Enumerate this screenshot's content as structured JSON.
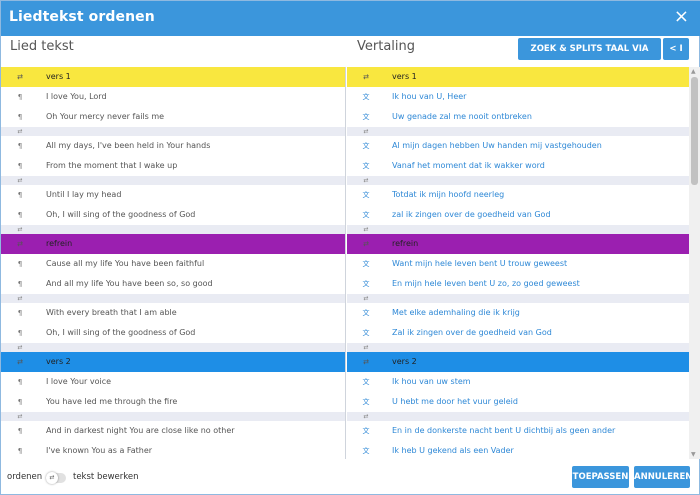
{
  "dialog": {
    "title": "Liedtekst ordenen",
    "close_icon": "×"
  },
  "columns": {
    "left_title": "Lied tekst",
    "right_title": "Vertaling"
  },
  "toolbar": {
    "deepl_label": "ZOEK & SPLITS TAAL VIA DEEPL",
    "collapse_label": "< I"
  },
  "icons": {
    "swap": "⇄",
    "para": "¶",
    "translate": "文"
  },
  "colors": {
    "accent": "#3b96dc",
    "vers": "#f9e73f",
    "refrein": "#9b1fb0",
    "vers2": "#1e8ee6"
  },
  "left": [
    {
      "kind": "header",
      "variant": "vers",
      "text": "vers 1"
    },
    {
      "kind": "line",
      "text": "I love You, Lord"
    },
    {
      "kind": "line",
      "text": "Oh Your mercy never fails me"
    },
    {
      "kind": "sep"
    },
    {
      "kind": "line",
      "text": "All my days, I've been held in Your hands"
    },
    {
      "kind": "line",
      "text": "From the moment that I wake up"
    },
    {
      "kind": "sep"
    },
    {
      "kind": "line",
      "text": "Until I lay my head"
    },
    {
      "kind": "line",
      "text": "Oh, I will sing of the goodness of God"
    },
    {
      "kind": "sep"
    },
    {
      "kind": "header",
      "variant": "refrein",
      "text": "refrein"
    },
    {
      "kind": "line",
      "text": "Cause all my life You have been faithful"
    },
    {
      "kind": "line",
      "text": "And all my life You have been so, so good"
    },
    {
      "kind": "sep"
    },
    {
      "kind": "line",
      "text": "With every breath that I am able"
    },
    {
      "kind": "line",
      "text": "Oh, I will sing of the goodness of God"
    },
    {
      "kind": "sep"
    },
    {
      "kind": "header",
      "variant": "vers2",
      "text": "vers 2"
    },
    {
      "kind": "line",
      "text": "I love Your voice"
    },
    {
      "kind": "line",
      "text": "You have led me through the fire"
    },
    {
      "kind": "sep"
    },
    {
      "kind": "line",
      "text": "And in darkest night You are close like no other"
    },
    {
      "kind": "line",
      "text": "I've known You as a Father"
    }
  ],
  "right": [
    {
      "kind": "header",
      "variant": "vers",
      "text": "vers 1"
    },
    {
      "kind": "line",
      "text": "Ik hou van U, Heer"
    },
    {
      "kind": "line",
      "text": "Uw genade zal me nooit ontbreken"
    },
    {
      "kind": "sep"
    },
    {
      "kind": "line",
      "text": "Al mijn dagen hebben Uw handen mij vastgehouden"
    },
    {
      "kind": "line",
      "text": "Vanaf het moment dat ik wakker word"
    },
    {
      "kind": "sep"
    },
    {
      "kind": "line",
      "text": "Totdat ik mijn hoofd neerleg"
    },
    {
      "kind": "line",
      "text": "zal ik zingen over de goedheid van God"
    },
    {
      "kind": "sep"
    },
    {
      "kind": "header",
      "variant": "refrein",
      "text": "refrein"
    },
    {
      "kind": "line",
      "text": "Want mijn hele leven bent U trouw geweest"
    },
    {
      "kind": "line",
      "text": "En mijn hele leven bent U zo, zo goed geweest"
    },
    {
      "kind": "sep"
    },
    {
      "kind": "line",
      "text": "Met elke ademhaling die ik krijg"
    },
    {
      "kind": "line",
      "text": "Zal ik zingen over de goedheid van God"
    },
    {
      "kind": "sep"
    },
    {
      "kind": "header",
      "variant": "vers2",
      "text": "vers 2"
    },
    {
      "kind": "line",
      "text": "Ik hou van uw stem"
    },
    {
      "kind": "line",
      "text": "U hebt me door het vuur geleid"
    },
    {
      "kind": "sep"
    },
    {
      "kind": "line",
      "text": "En in de donkerste nacht bent U dichtbij als geen ander"
    },
    {
      "kind": "line",
      "text": "Ik heb U gekend als een Vader"
    }
  ],
  "footer": {
    "order_label": "ordenen",
    "edit_label": "tekst bewerken",
    "apply_label": "TOEPASSEN",
    "cancel_label": "ANNULEREN"
  }
}
